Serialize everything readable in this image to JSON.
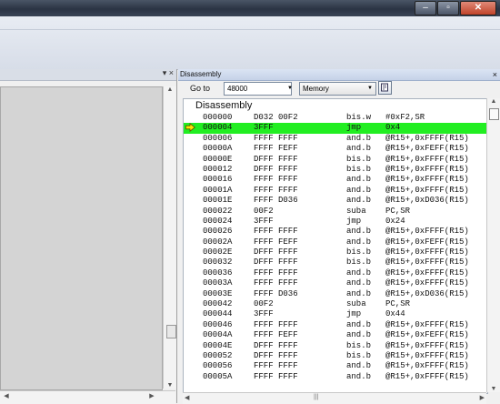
{
  "window": {
    "minimize_glyph": "–",
    "maximize_glyph": "▫",
    "close_glyph": "✕"
  },
  "left_panel": {
    "header_controls": "▾ ×"
  },
  "disassembly_panel": {
    "title": "Disassembly",
    "header_controls": "×",
    "goto_label": "Go to",
    "goto_value": "48000",
    "memory_label": "Memory",
    "list_title": "Disassembly",
    "current_row": 1,
    "current_color": "#22ee22",
    "rows": [
      {
        "address": "000000",
        "opcode": "D032 00F2",
        "mnemonic": "bis.w",
        "operands": "#0xF2,SR"
      },
      {
        "address": "000004",
        "opcode": "3FFF",
        "mnemonic": "jmp",
        "operands": "0x4"
      },
      {
        "address": "000006",
        "opcode": "FFFF FFFF",
        "mnemonic": "and.b",
        "operands": "@R15+,0xFFFF(R15)"
      },
      {
        "address": "00000A",
        "opcode": "FFFF FEFF",
        "mnemonic": "and.b",
        "operands": "@R15+,0xFEFF(R15)"
      },
      {
        "address": "00000E",
        "opcode": "DFFF FFFF",
        "mnemonic": "bis.b",
        "operands": "@R15+,0xFFFF(R15)"
      },
      {
        "address": "000012",
        "opcode": "DFFF FFFF",
        "mnemonic": "bis.b",
        "operands": "@R15+,0xFFFF(R15)"
      },
      {
        "address": "000016",
        "opcode": "FFFF FFFF",
        "mnemonic": "and.b",
        "operands": "@R15+,0xFFFF(R15)"
      },
      {
        "address": "00001A",
        "opcode": "FFFF FFFF",
        "mnemonic": "and.b",
        "operands": "@R15+,0xFFFF(R15)"
      },
      {
        "address": "00001E",
        "opcode": "FFFF D036",
        "mnemonic": "and.b",
        "operands": "@R15+,0xD036(R15)"
      },
      {
        "address": "000022",
        "opcode": "00F2",
        "mnemonic": "suba",
        "operands": "PC,SR"
      },
      {
        "address": "000024",
        "opcode": "3FFF",
        "mnemonic": "jmp",
        "operands": "0x24"
      },
      {
        "address": "000026",
        "opcode": "FFFF FFFF",
        "mnemonic": "and.b",
        "operands": "@R15+,0xFFFF(R15)"
      },
      {
        "address": "00002A",
        "opcode": "FFFF FEFF",
        "mnemonic": "and.b",
        "operands": "@R15+,0xFEFF(R15)"
      },
      {
        "address": "00002E",
        "opcode": "DFFF FFFF",
        "mnemonic": "bis.b",
        "operands": "@R15+,0xFFFF(R15)"
      },
      {
        "address": "000032",
        "opcode": "DFFF FFFF",
        "mnemonic": "bis.b",
        "operands": "@R15+,0xFFFF(R15)"
      },
      {
        "address": "000036",
        "opcode": "FFFF FFFF",
        "mnemonic": "and.b",
        "operands": "@R15+,0xFFFF(R15)"
      },
      {
        "address": "00003A",
        "opcode": "FFFF FFFF",
        "mnemonic": "and.b",
        "operands": "@R15+,0xFFFF(R15)"
      },
      {
        "address": "00003E",
        "opcode": "FFFF D036",
        "mnemonic": "and.b",
        "operands": "@R15+,0xD036(R15)"
      },
      {
        "address": "000042",
        "opcode": "00F2",
        "mnemonic": "suba",
        "operands": "PC,SR"
      },
      {
        "address": "000044",
        "opcode": "3FFF",
        "mnemonic": "jmp",
        "operands": "0x44"
      },
      {
        "address": "000046",
        "opcode": "FFFF FFFF",
        "mnemonic": "and.b",
        "operands": "@R15+,0xFFFF(R15)"
      },
      {
        "address": "00004A",
        "opcode": "FFFF FEFF",
        "mnemonic": "and.b",
        "operands": "@R15+,0xFEFF(R15)"
      },
      {
        "address": "00004E",
        "opcode": "DFFF FFFF",
        "mnemonic": "bis.b",
        "operands": "@R15+,0xFFFF(R15)"
      },
      {
        "address": "000052",
        "opcode": "DFFF FFFF",
        "mnemonic": "bis.b",
        "operands": "@R15+,0xFFFF(R15)"
      },
      {
        "address": "000056",
        "opcode": "FFFF FFFF",
        "mnemonic": "and.b",
        "operands": "@R15+,0xFFFF(R15)"
      },
      {
        "address": "00005A",
        "opcode": "FFFF FFFF",
        "mnemonic": "and.b",
        "operands": "@R15+,0xFFFF(R15)"
      }
    ]
  },
  "icons": {
    "current_instruction": "arrow-right-icon",
    "refresh": "refresh-icon"
  }
}
